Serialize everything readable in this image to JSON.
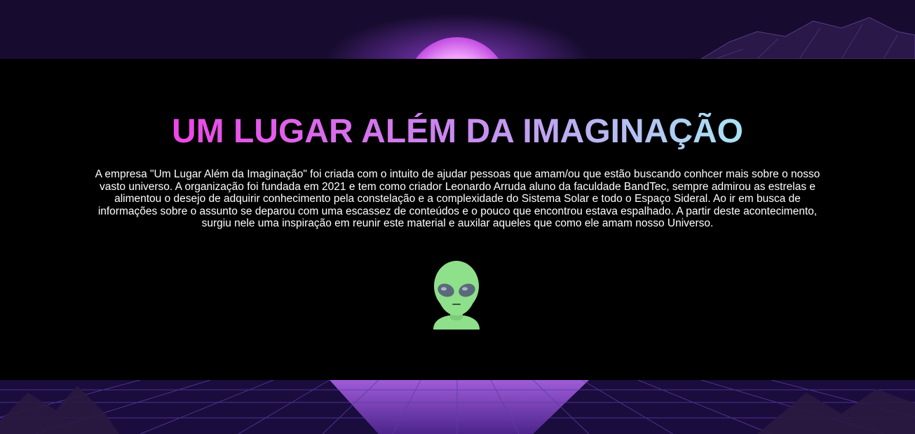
{
  "page": {
    "title": "UM LUGAR ALÉM DA IMAGINAÇÃO",
    "description": "A empresa \"Um Lugar Além da Imaginação\" foi criada com o intuito de ajudar pessoas que amam/ou que estão buscando conhcer mais sobre o nosso vasto universo. A organização foi fundada em 2021 e tem como criador Leonardo Arruda aluno da faculdade BandTec, sempre admirou as estrelas e alimentou o desejo de adquirir conhecimento pela constelação e a complexidade do Sistema Solar e todo o Espaço Sideral. Ao ir em busca de informações sobre o assunto se deparou com uma escassez de conteúdos e o pouco que encontrou estava espalhado. A partir deste acontecimento, surgiu nele uma inspiração em reunir este material e auxilar aqueles que como ele amam nosso Universo.",
    "icon": "alien-icon"
  },
  "colors": {
    "panel": "#000000",
    "title_gradient": [
      "#ee46e6",
      "#c989f0",
      "#a8e4f4"
    ],
    "text": "#ffffff",
    "alien_skin": "#8ee08a",
    "alien_eyes": "#5a6a7a"
  }
}
